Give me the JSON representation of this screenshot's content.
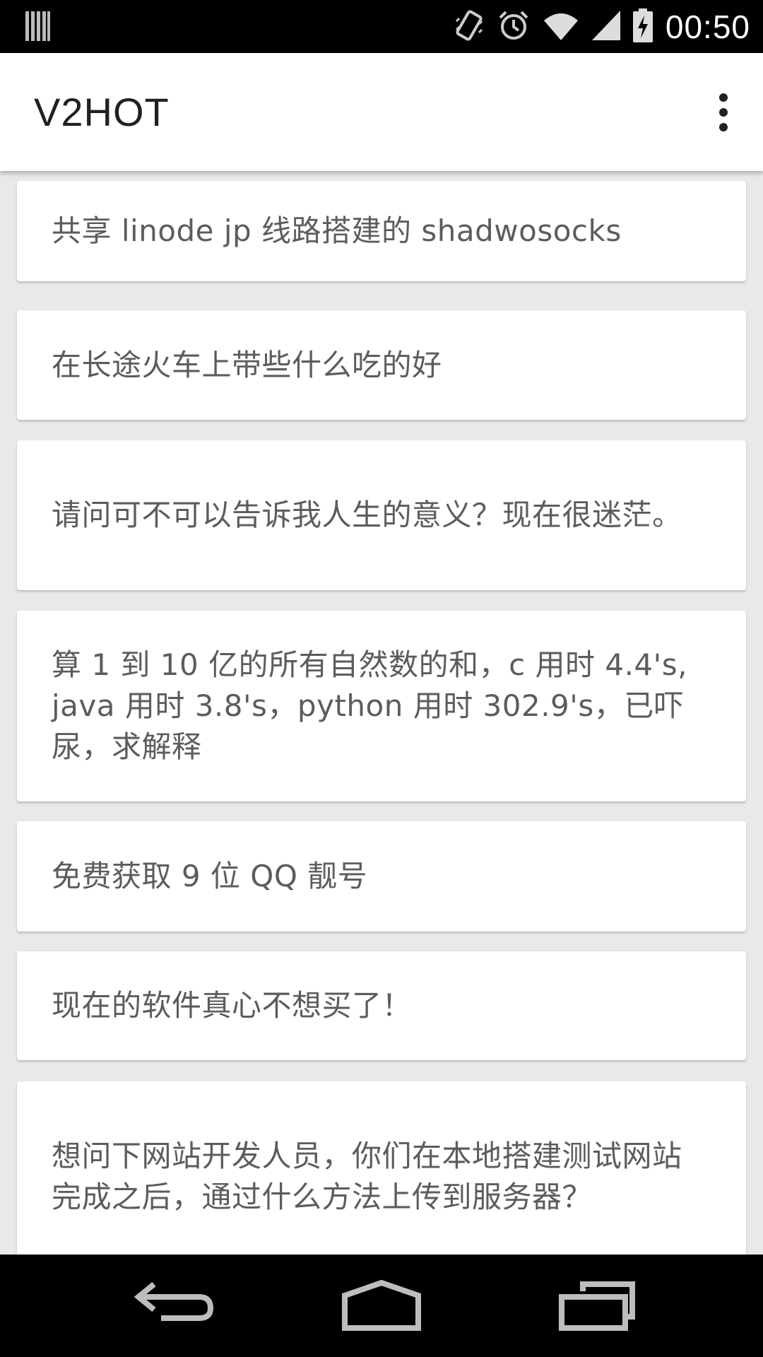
{
  "status_bar": {
    "time": "00:50",
    "icons": [
      "barcode-notification-icon",
      "vibrate-icon",
      "alarm-icon",
      "wifi-icon",
      "signal-icon",
      "battery-charging-icon"
    ]
  },
  "app_bar": {
    "title": "V2HOT",
    "menu_icon": "overflow-menu-icon"
  },
  "topics": [
    "共享 linode jp 线路搭建的 shadwosocks",
    "在长途火车上带些什么吃的好",
    "请问可不可以告诉我人生的意义？现在很迷茫。",
    "算 1 到 10 亿的所有自然数的和，c 用时 4.4's, java 用时 3.8's，python 用时 302.9's，已吓尿，求解释",
    "免费获取 9 位 QQ 靓号",
    "现在的软件真心不想买了！",
    "想问下网站开发人员，你们在本地搭建测试网站完成之后，通过什么方法上传到服务器？"
  ],
  "nav_bar": {
    "buttons": [
      "back-icon",
      "home-icon",
      "recent-apps-icon"
    ]
  },
  "colors": {
    "status_bar": "#000000",
    "app_bar": "#ffffff",
    "background": "#e9e9e9",
    "card": "#ffffff",
    "text": "#5c5c5c"
  }
}
